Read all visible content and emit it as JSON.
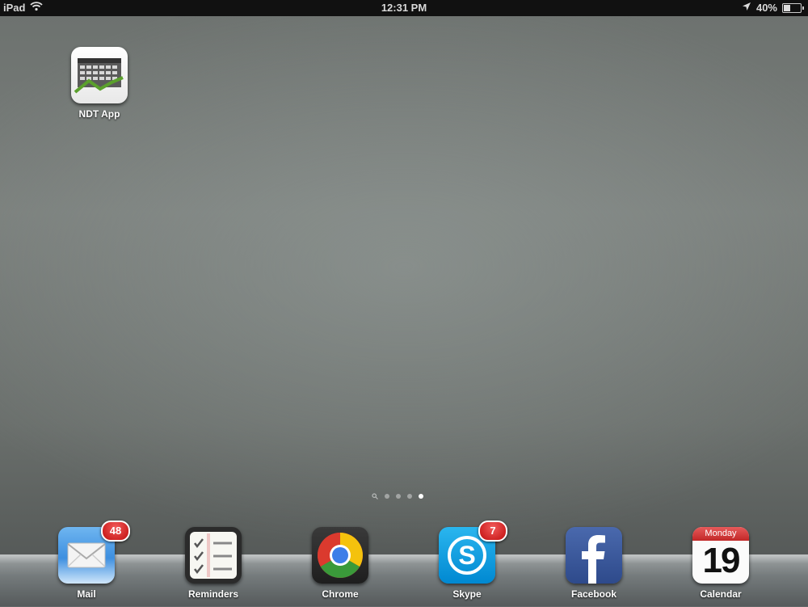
{
  "statusbar": {
    "device": "iPad",
    "time": "12:31 PM",
    "battery": "40%"
  },
  "home": {
    "apps": [
      {
        "label": "NDT App",
        "icon": "ndt-calendar-chart-icon"
      }
    ]
  },
  "page_indicator": {
    "pages": 4,
    "current": 4,
    "has_spotlight": true
  },
  "dock": {
    "apps": [
      {
        "label": "Mail",
        "badge": "48",
        "icon": "mail-envelope-icon"
      },
      {
        "label": "Reminders",
        "badge": "",
        "icon": "reminders-checklist-icon"
      },
      {
        "label": "Chrome",
        "badge": "",
        "icon": "chrome-logo-icon"
      },
      {
        "label": "Skype",
        "badge": "7",
        "icon": "skype-logo-icon"
      },
      {
        "label": "Facebook",
        "badge": "",
        "icon": "facebook-f-icon"
      },
      {
        "label": "Calendar",
        "badge": "",
        "icon": "calendar-icon",
        "weekday": "Monday",
        "day": "19"
      }
    ]
  }
}
